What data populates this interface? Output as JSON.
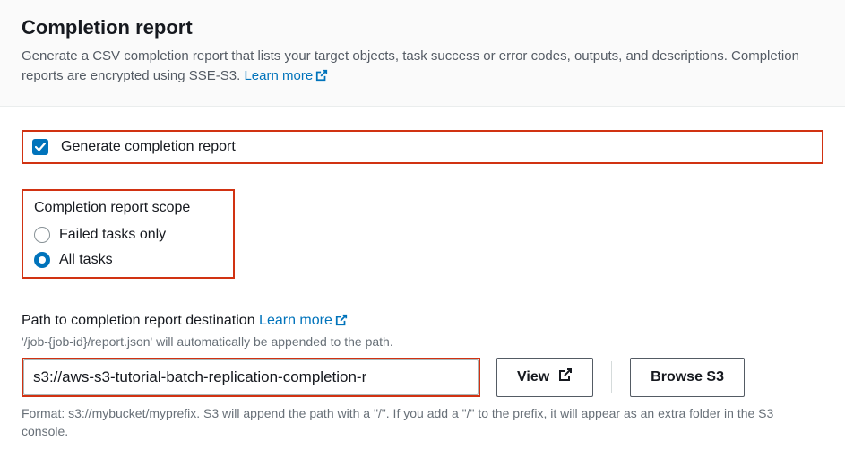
{
  "header": {
    "title": "Completion report",
    "description": "Generate a CSV completion report that lists your target objects, task success or error codes, outputs, and descriptions. Completion reports are encrypted using SSE-S3. ",
    "learn_more": "Learn more"
  },
  "generate": {
    "label": "Generate completion report",
    "checked": true
  },
  "scope": {
    "title": "Completion report scope",
    "options": [
      {
        "label": "Failed tasks only",
        "selected": false
      },
      {
        "label": "All tasks",
        "selected": true
      }
    ]
  },
  "path": {
    "label": "Path to completion report destination ",
    "learn_more": "Learn more",
    "hint": "'/job-{job-id}/report.json' will automatically be appended to the path.",
    "value": "s3://aws-s3-tutorial-batch-replication-completion-r",
    "view_label": "View",
    "browse_label": "Browse S3",
    "format_hint": "Format: s3://mybucket/myprefix. S3 will append the path with a \"/\". If you add a \"/\" to the prefix, it will appear as an extra folder in the S3 console."
  }
}
